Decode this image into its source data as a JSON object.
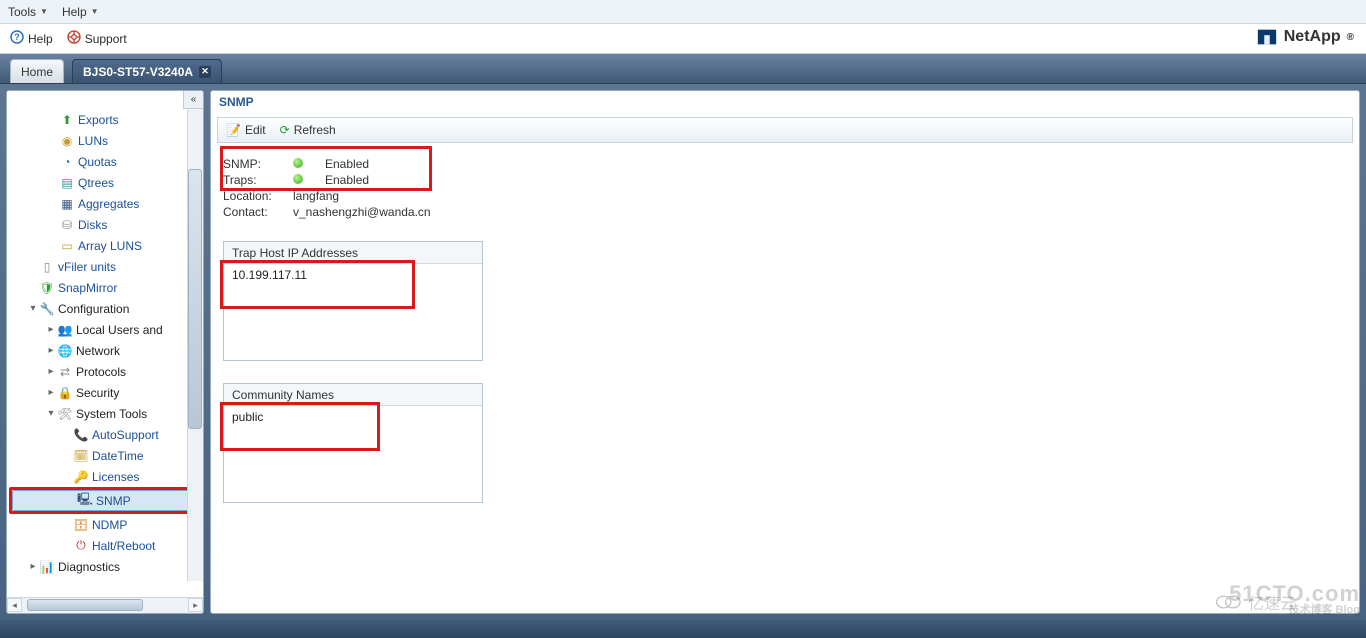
{
  "menubar": {
    "tools": "Tools",
    "help": "Help"
  },
  "helpbar": {
    "help": "Help",
    "support": "Support"
  },
  "brand": "NetApp",
  "tabs": {
    "home": "Home",
    "active": "BJS0-ST57-V3240A"
  },
  "tree": {
    "exports": "Exports",
    "luns": "LUNs",
    "quotas": "Quotas",
    "qtrees": "Qtrees",
    "aggregates": "Aggregates",
    "disks": "Disks",
    "arrayluns": "Array LUNS",
    "vfiler": "vFiler units",
    "snapmirror": "SnapMirror",
    "configuration": "Configuration",
    "localusers": "Local Users and",
    "network": "Network",
    "protocols": "Protocols",
    "security": "Security",
    "systemtools": "System Tools",
    "autosupport": "AutoSupport",
    "datetime": "DateTime",
    "licenses": "Licenses",
    "snmp": "SNMP",
    "ndmp": "NDMP",
    "haltreboot": "Halt/Reboot",
    "diagnostics": "Diagnostics"
  },
  "main": {
    "title": "SNMP",
    "edit": "Edit",
    "refresh": "Refresh",
    "info": {
      "snmp_k": "SNMP:",
      "snmp_v": "Enabled",
      "traps_k": "Traps:",
      "traps_v": "Enabled",
      "loc_k": "Location:",
      "loc_v": "langfang",
      "contact_k": "Contact:",
      "contact_v": "v_nashengzhi@wanda.cn"
    },
    "trap": {
      "title": "Trap Host IP Addresses",
      "item": "10.199.117.11"
    },
    "community": {
      "title": "Community Names",
      "item": "public"
    }
  },
  "watermark": {
    "line1": "51CTO.com",
    "line2": "技术博客  Blog",
    "line3": "亿速云"
  }
}
